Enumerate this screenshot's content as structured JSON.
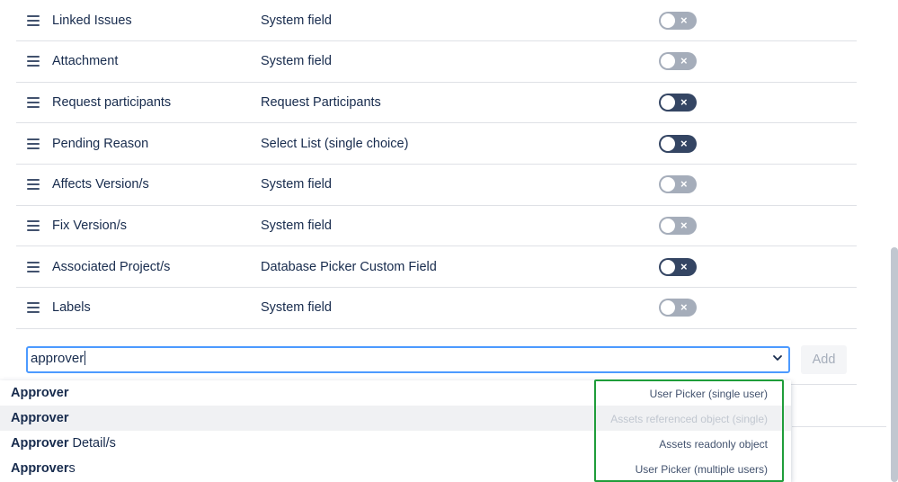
{
  "fields": [
    {
      "name": "Linked Issues",
      "type": "System field",
      "enabled": false
    },
    {
      "name": "Attachment",
      "type": "System field",
      "enabled": false
    },
    {
      "name": "Request participants",
      "type": "Request Participants",
      "enabled": true
    },
    {
      "name": "Pending Reason",
      "type": "Select List (single choice)",
      "enabled": true
    },
    {
      "name": "Affects Version/s",
      "type": "System field",
      "enabled": false
    },
    {
      "name": "Fix Version/s",
      "type": "System field",
      "enabled": false
    },
    {
      "name": "Associated Project/s",
      "type": "Database Picker Custom Field",
      "enabled": true
    },
    {
      "name": "Labels",
      "type": "System field",
      "enabled": false
    }
  ],
  "toggle_icon": "×",
  "search": {
    "value": "approver"
  },
  "add_button": {
    "label": "Add"
  },
  "dropdown": {
    "options": [
      {
        "match": "Approver",
        "rest": "",
        "type": "User Picker (single user)",
        "disabled": false,
        "highlighted": false
      },
      {
        "match": "Approver",
        "rest": "",
        "type": "Assets referenced object (single)",
        "disabled": true,
        "highlighted": true
      },
      {
        "match": "Approver",
        "rest": " Detail/s",
        "type": "Assets readonly object",
        "disabled": false,
        "highlighted": false
      },
      {
        "match": "Approver",
        "rest": "s",
        "type": "User Picker (multiple users)",
        "disabled": false,
        "highlighted": false
      }
    ]
  },
  "colors": {
    "toggle_on": "#344563",
    "toggle_off": "#a5adba",
    "focus_border": "#4c9aff",
    "callout": "#1f9d3a"
  }
}
